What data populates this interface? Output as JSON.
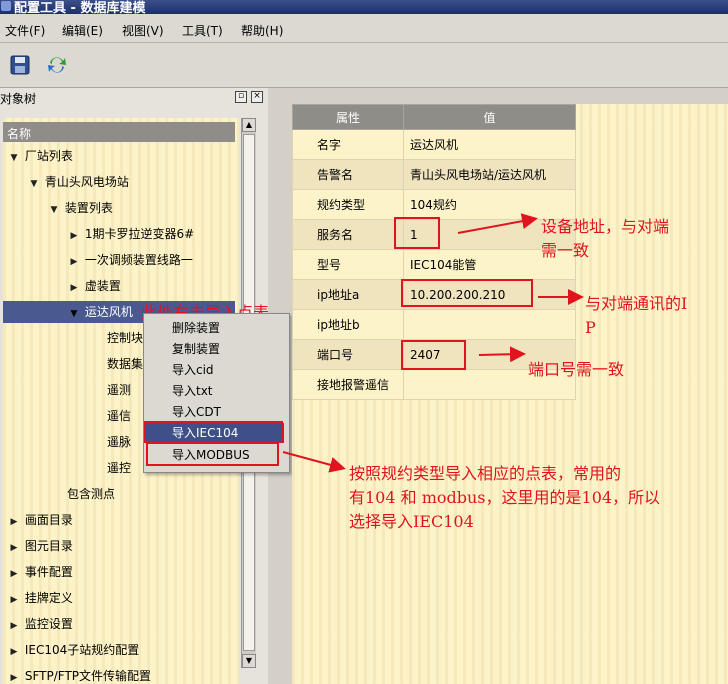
{
  "window": {
    "title": "配置工具 - 数据库建模"
  },
  "menubar": {
    "items": [
      {
        "label": "文件(F)"
      },
      {
        "label": "编辑(E)"
      },
      {
        "label": "视图(V)"
      },
      {
        "label": "工具(T)"
      },
      {
        "label": "帮助(H)"
      }
    ]
  },
  "toolbar": {
    "buttons": [
      {
        "icon": "floppy-disk-icon"
      },
      {
        "icon": "refresh-icon"
      }
    ]
  },
  "object_tree": {
    "title": "对象树",
    "column_header": "名称",
    "nodes": [
      {
        "label": "厂站列表",
        "expanded": true
      },
      {
        "label": "青山头风电场站",
        "expanded": true
      },
      {
        "label": "装置列表",
        "expanded": true
      },
      {
        "label": "1期卡罗拉逆变器6#",
        "expanded": false
      },
      {
        "label": "一次调频装置线路一",
        "expanded": false
      },
      {
        "label": "虚装置",
        "expanded": false
      },
      {
        "label": "运达风机",
        "expanded": true,
        "selected": true
      },
      {
        "label": "控制块"
      },
      {
        "label": "数据集"
      },
      {
        "label": "遥测"
      },
      {
        "label": "遥信"
      },
      {
        "label": "遥脉"
      },
      {
        "label": "遥控"
      },
      {
        "label": "包含测点"
      },
      {
        "label": "画面目录",
        "expanded": false
      },
      {
        "label": "图元目录",
        "expanded": false
      },
      {
        "label": "事件配置",
        "expanded": false
      },
      {
        "label": "挂牌定义",
        "expanded": false
      },
      {
        "label": "监控设置",
        "expanded": false
      },
      {
        "label": "IEC104子站规约配置",
        "expanded": false
      },
      {
        "label": "SFTP/FTP文件传输配置",
        "expanded": false
      }
    ]
  },
  "context_menu": {
    "items": [
      {
        "label": "删除装置"
      },
      {
        "label": "复制装置"
      },
      {
        "label": "导入cid"
      },
      {
        "label": "导入txt"
      },
      {
        "label": "导入CDT"
      },
      {
        "label": "导入IEC104",
        "highlighted": true
      },
      {
        "label": "导入MODBUS"
      }
    ]
  },
  "properties": {
    "headers": [
      "属性",
      "值"
    ],
    "rows": [
      {
        "name": "名字",
        "value": "运达风机"
      },
      {
        "name": "告警名",
        "value": "青山头风电场站/运达风机"
      },
      {
        "name": "规约类型",
        "value": "104规约"
      },
      {
        "name": "服务名",
        "value": "1"
      },
      {
        "name": "型号",
        "value": "IEC104能管"
      },
      {
        "name": "ip地址a",
        "value": "10.200.200.210"
      },
      {
        "name": "ip地址b",
        "value": ""
      },
      {
        "name": "端口号",
        "value": "2407"
      },
      {
        "name": "接地报警遥信",
        "value": ""
      }
    ]
  },
  "annotations": {
    "right_click_hint": "此处右击导入点表",
    "device_address": "设备地址，与对端\n需一致",
    "ip_note": "与对端通讯的I\nP",
    "port_note": "端口号需一致",
    "import_note": "按照规约类型导入相应的点表，常用的\n有104 和 modbus，这里用的是104，所以\n选择导入IEC104",
    "color": "#e0141e"
  }
}
